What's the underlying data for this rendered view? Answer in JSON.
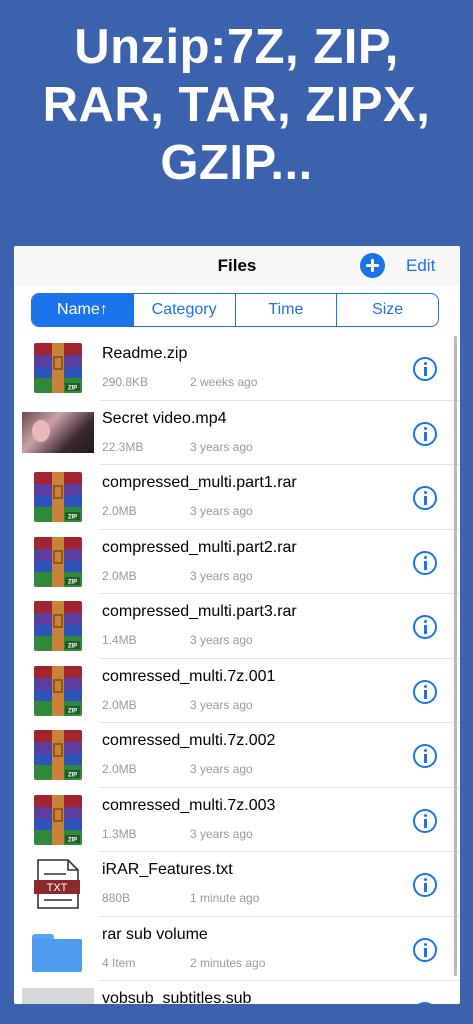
{
  "headline": {
    "line1": "Unzip:7Z, ZIP,",
    "line2": "RAR, TAR, ZIPX,",
    "line3": "GZIP..."
  },
  "navbar": {
    "title": "Files",
    "add_icon": "plus-circle-icon",
    "edit_label": "Edit"
  },
  "sort_tabs": [
    {
      "label": "Name↑",
      "active": true
    },
    {
      "label": "Category",
      "active": false
    },
    {
      "label": "Time",
      "active": false
    },
    {
      "label": "Size",
      "active": false
    }
  ],
  "files": [
    {
      "name": "Readme.zip",
      "size": "290.8KB",
      "date": "2 weeks ago",
      "icon": "zip-archive-icon"
    },
    {
      "name": "Secret video.mp4",
      "size": "22.3MB",
      "date": "3 years ago",
      "icon": "video-thumbnail"
    },
    {
      "name": "compressed_multi.part1.rar",
      "size": "2.0MB",
      "date": "3 years ago",
      "icon": "zip-archive-icon"
    },
    {
      "name": "compressed_multi.part2.rar",
      "size": "2.0MB",
      "date": "3 years ago",
      "icon": "zip-archive-icon"
    },
    {
      "name": "compressed_multi.part3.rar",
      "size": "1.4MB",
      "date": "3 years ago",
      "icon": "zip-archive-icon"
    },
    {
      "name": "comressed_multi.7z.001",
      "size": "2.0MB",
      "date": "3 years ago",
      "icon": "zip-archive-icon"
    },
    {
      "name": "comressed_multi.7z.002",
      "size": "2.0MB",
      "date": "3 years ago",
      "icon": "zip-archive-icon"
    },
    {
      "name": "comressed_multi.7z.003",
      "size": "1.3MB",
      "date": "3 years ago",
      "icon": "zip-archive-icon"
    },
    {
      "name": "iRAR_Features.txt",
      "size": "880B",
      "date": "1 minute ago",
      "icon": "txt-file-icon"
    },
    {
      "name": "rar sub volume",
      "size": "4 Item",
      "date": "2 minutes ago",
      "icon": "folder-icon"
    },
    {
      "name": "vobsub_subtitles.sub",
      "size": "",
      "date": "",
      "icon": "generic-file-icon"
    }
  ],
  "icon_labels": {
    "zip": "ZIP",
    "txt": "TXT"
  },
  "colors": {
    "background": "#3a62ad",
    "accent": "#1a73e8"
  }
}
